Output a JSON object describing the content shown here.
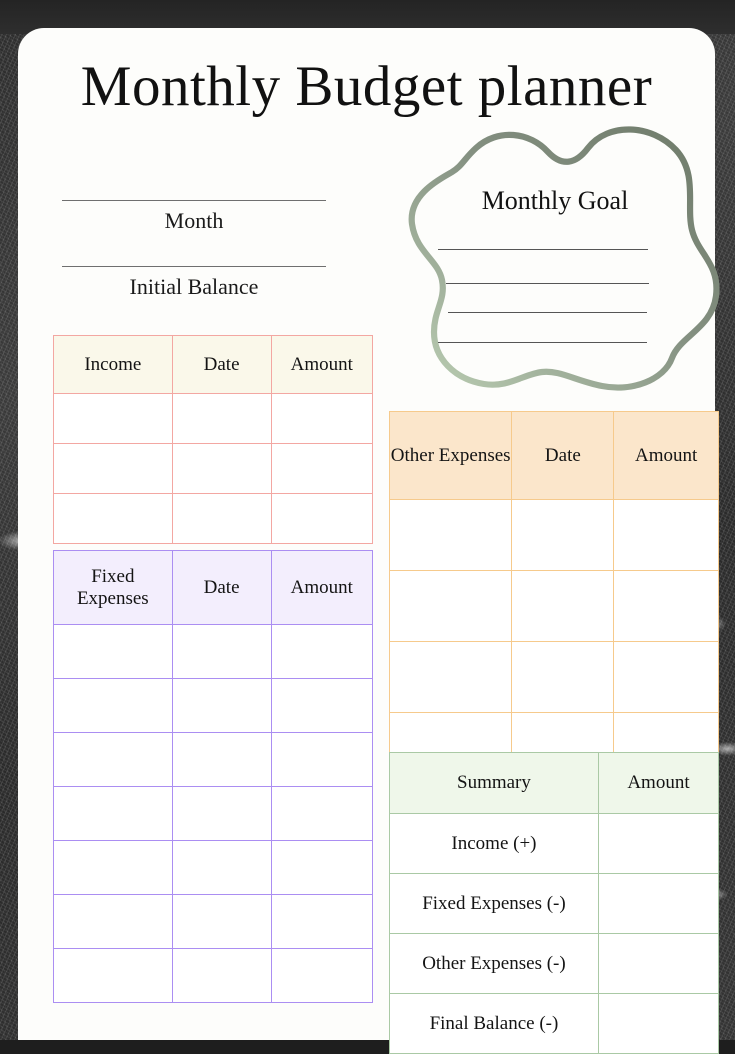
{
  "page": {
    "title": "Monthly Budget planner"
  },
  "fields": {
    "month": {
      "label": "Month"
    },
    "initial_balance": {
      "label": "Initial Balance"
    }
  },
  "goal": {
    "title": "Monthly Goal",
    "line_count": 4,
    "outline_color": "#7d8c77",
    "outline_color_light": "#b8ccb0"
  },
  "tables": {
    "income": {
      "name": "Income",
      "accent": "#f3a7a2",
      "header_fill": "#faf8ea",
      "headers": [
        "Income",
        "Date",
        "Amount"
      ],
      "rows": [
        [
          "",
          "",
          ""
        ],
        [
          "",
          "",
          ""
        ],
        [
          "",
          "",
          ""
        ]
      ]
    },
    "fixed_expenses": {
      "name": "Fixed Expenses",
      "accent": "#ab8ef2",
      "header_fill": "#f3eefd",
      "headers": [
        "Fixed Expenses",
        "Date",
        "Amount"
      ],
      "rows": [
        [
          "",
          "",
          ""
        ],
        [
          "",
          "",
          ""
        ],
        [
          "",
          "",
          ""
        ],
        [
          "",
          "",
          ""
        ],
        [
          "",
          "",
          ""
        ],
        [
          "",
          "",
          ""
        ],
        [
          "",
          "",
          ""
        ]
      ]
    },
    "other_expenses": {
      "name": "Other Expenses",
      "accent": "#f6ca8c",
      "header_fill": "#fbe6cb",
      "headers": [
        "Other Expenses",
        "Date",
        "Amount"
      ],
      "rows": [
        [
          "",
          "",
          ""
        ],
        [
          "",
          "",
          ""
        ],
        [
          "",
          "",
          ""
        ],
        [
          "",
          "",
          ""
        ]
      ]
    },
    "summary": {
      "name": "Summary",
      "accent": "#aac9a5",
      "header_fill": "#eff7ea",
      "headers": [
        "Summary",
        "Amount"
      ],
      "rows": [
        {
          "label": "Income (+)",
          "amount": ""
        },
        {
          "label": "Fixed Expenses (-)",
          "amount": ""
        },
        {
          "label": "Other Expenses (-)",
          "amount": ""
        },
        {
          "label": "Final Balance (-)",
          "amount": ""
        }
      ]
    }
  }
}
